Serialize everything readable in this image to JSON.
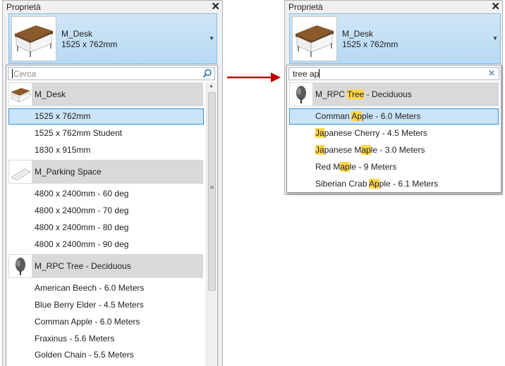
{
  "left_panel": {
    "title": "Proprietà",
    "close": "✕",
    "selector": {
      "name": "M_Desk",
      "size": "1525 x 762mm",
      "caret": "▼"
    },
    "search": {
      "placeholder": "Cerca",
      "value": ""
    },
    "groups": [
      {
        "header": "M_Desk",
        "thumb": "desk-thumb",
        "items": [
          "1525 x 762mm",
          "1525 x 762mm Student",
          "1830 x 915mm"
        ],
        "selected_index": 0
      },
      {
        "header": "M_Parking Space",
        "thumb": "parking-thumb",
        "items": [
          "4800 x 2400mm - 60 deg",
          "4800 x 2400mm - 70 deg",
          "4800 x 2400mm - 80 deg",
          "4800 x 2400mm - 90 deg"
        ]
      },
      {
        "header": "M_RPC Tree - Deciduous",
        "thumb": "tree-thumb",
        "items": [
          "American Beech - 6.0 Meters",
          "Blue Berry Elder - 4.5 Meters",
          "Comman Apple - 6.0 Meters",
          "Fraxinus - 5.6 Meters",
          "Golden Chain - 5.5 Meters"
        ]
      }
    ]
  },
  "right_panel": {
    "title": "Proprietà",
    "close": "✕",
    "selector": {
      "name": "M_Desk",
      "size": "1525 x 762mm",
      "caret": "▼"
    },
    "search": {
      "value": "tree ap",
      "clear": "✕"
    },
    "group": {
      "header_parts": [
        "M_RPC ",
        "Tree",
        " - Deciduous"
      ],
      "thumb": "tree-thumb"
    },
    "items": [
      {
        "parts": [
          "Comman ",
          "Ap",
          "ple - 6.0 Meters"
        ],
        "selected": true
      },
      {
        "parts": [
          "",
          "Ja",
          "panese Cherry - 4.5 Meters"
        ]
      },
      {
        "parts": [
          "",
          "Ja",
          "panese Maple - 3.0 Meters"
        ],
        "second_hl": [
          "Japanese M",
          "ap",
          "le - 3.0 Meters"
        ]
      },
      {
        "parts": [
          "Red M",
          "ap",
          "le - 9 Meters"
        ]
      },
      {
        "parts": [
          "Siberian Crab ",
          "Ap",
          "ple - 6.1 Meters"
        ]
      }
    ]
  },
  "colors": {
    "highlight": "#ffd64a",
    "selection_bg": "#cbe4f7",
    "selection_border": "#3c8fd1",
    "arrow": "#c00000"
  }
}
